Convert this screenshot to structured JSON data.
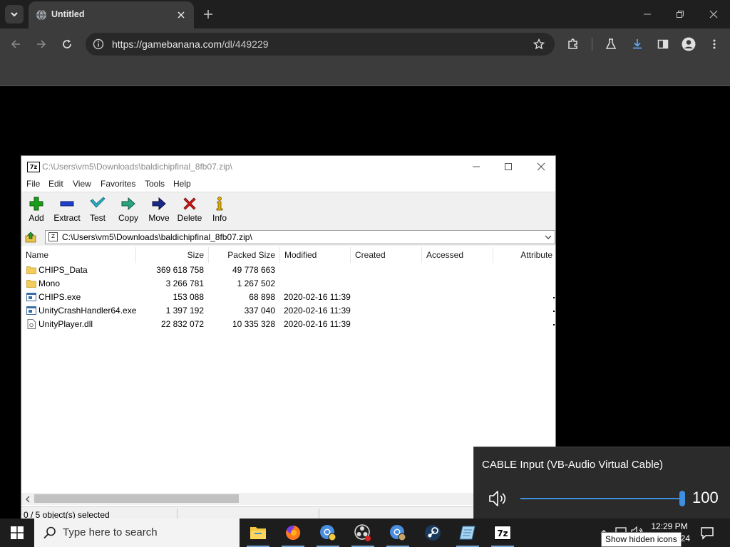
{
  "browser": {
    "tab_title": "Untitled",
    "url_host": "https://gamebanana.com",
    "url_path": "/dl/449229"
  },
  "zip_window": {
    "title": "C:\\Users\\vm5\\Downloads\\baldichipfinal_8fb07.zip\\",
    "app_icon": "7z",
    "menu": [
      "File",
      "Edit",
      "View",
      "Favorites",
      "Tools",
      "Help"
    ],
    "toolbar": [
      {
        "label": "Add",
        "icon": "plus-icon",
        "color": "#1a9e1a"
      },
      {
        "label": "Extract",
        "icon": "minus-icon",
        "color": "#1f3fcf"
      },
      {
        "label": "Test",
        "icon": "check-icon",
        "color": "#2ab0c8"
      },
      {
        "label": "Copy",
        "icon": "arrow-right-icon",
        "color": "#2aa580"
      },
      {
        "label": "Move",
        "icon": "arrow-right-icon",
        "color": "#1a2a8a"
      },
      {
        "label": "Delete",
        "icon": "x-icon",
        "color": "#d01818"
      },
      {
        "label": "Info",
        "icon": "info-icon",
        "color": "#c8a000"
      }
    ],
    "address": "C:\\Users\\vm5\\Downloads\\baldichipfinal_8fb07.zip\\",
    "columns": [
      "Name",
      "Size",
      "Packed Size",
      "Modified",
      "Created",
      "Accessed",
      "Attribute"
    ],
    "files": [
      {
        "name": "CHIPS_Data",
        "type": "folder",
        "size": "369 618 758",
        "packed": "49 778 663",
        "modified": ""
      },
      {
        "name": "Mono",
        "type": "folder",
        "size": "3 266 781",
        "packed": "1 267 502",
        "modified": ""
      },
      {
        "name": "CHIPS.exe",
        "type": "exe",
        "size": "153 088",
        "packed": "68 898",
        "modified": "2020-02-16 11:39"
      },
      {
        "name": "UnityCrashHandler64.exe",
        "type": "exe",
        "size": "1 397 192",
        "packed": "337 040",
        "modified": "2020-02-16 11:39"
      },
      {
        "name": "UnityPlayer.dll",
        "type": "dll",
        "size": "22 832 072",
        "packed": "10 335 328",
        "modified": "2020-02-16 11:39"
      }
    ],
    "status": "0 / 5 object(s) selected"
  },
  "volume": {
    "device": "CABLE Input (VB-Audio Virtual Cable)",
    "level": 100,
    "level_text": "100",
    "accent": "#3f8fe0"
  },
  "taskbar": {
    "search_placeholder": "Type here to search",
    "time": "12:29 PM",
    "date_partial": "24",
    "tooltip": "Show hidden icons",
    "apps": [
      "file-explorer-icon",
      "firefox-icon",
      "chrome-icon",
      "obs-icon",
      "chrome-profile-icon",
      "steam-icon",
      "notepad-icon",
      "7zip-icon"
    ]
  }
}
